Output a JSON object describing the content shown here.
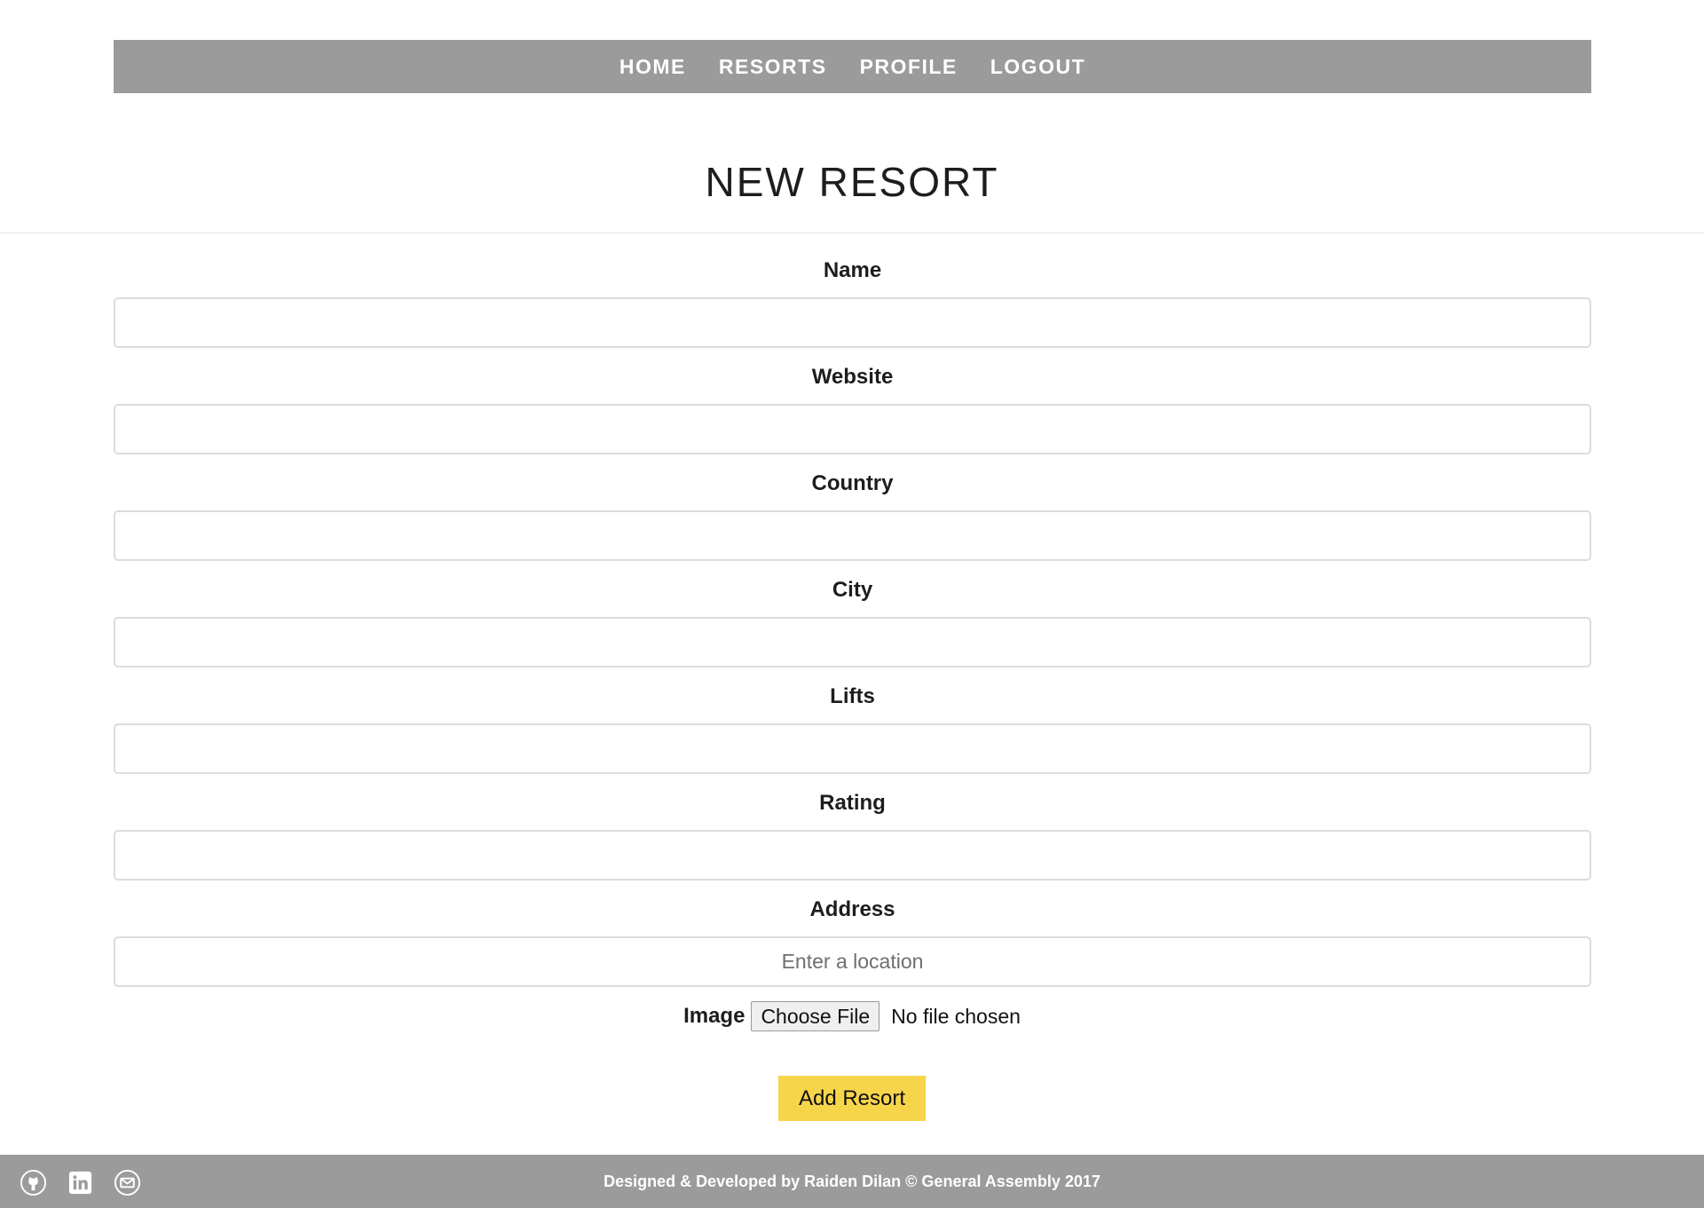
{
  "nav": {
    "items": [
      {
        "label": "HOME"
      },
      {
        "label": "RESORTS"
      },
      {
        "label": "PROFILE"
      },
      {
        "label": "LOGOUT"
      }
    ]
  },
  "page": {
    "title": "NEW RESORT"
  },
  "form": {
    "fields": [
      {
        "label": "Name",
        "value": "",
        "placeholder": ""
      },
      {
        "label": "Website",
        "value": "",
        "placeholder": ""
      },
      {
        "label": "Country",
        "value": "",
        "placeholder": ""
      },
      {
        "label": "City",
        "value": "",
        "placeholder": ""
      },
      {
        "label": "Lifts",
        "value": "",
        "placeholder": ""
      },
      {
        "label": "Rating",
        "value": "",
        "placeholder": ""
      },
      {
        "label": "Address",
        "value": "",
        "placeholder": "Enter a location"
      }
    ],
    "image": {
      "label": "Image",
      "button_label": "Choose File",
      "status": "No file chosen"
    },
    "submit_label": "Add Resort"
  },
  "footer": {
    "text": "Designed & Developed by Raiden Dilan © General Assembly 2017",
    "icons": [
      "github-icon",
      "linkedin-icon",
      "email-icon"
    ]
  },
  "colors": {
    "nav_bg": "#9b9b9b",
    "accent": "#f7d54a",
    "text": "#1d1d1d"
  }
}
